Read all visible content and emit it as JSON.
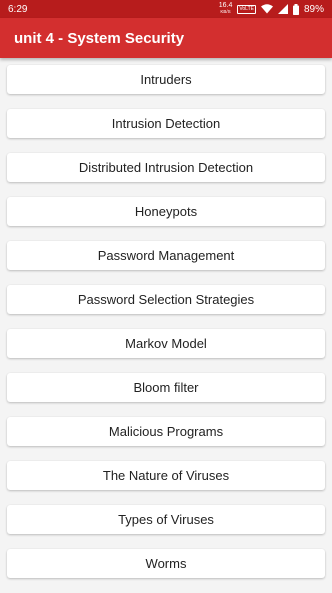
{
  "status_bar": {
    "time": "6:29",
    "net_speed_value": "16.4",
    "net_speed_unit": "KB/S",
    "volte": "VoLTE",
    "battery": "89%",
    "icons": [
      "wifi-icon",
      "signal-icon",
      "battery-icon"
    ]
  },
  "app_bar": {
    "title": "unit 4 - System Security"
  },
  "topics": [
    "Intruders",
    "Intrusion Detection",
    "Distributed Intrusion Detection",
    "Honeypots",
    "Password Management",
    "Password Selection Strategies",
    "Markov Model",
    "Bloom filter",
    "Malicious Programs",
    "The Nature of Viruses",
    "Types of Viruses",
    "Worms"
  ],
  "colors": {
    "app_bar": "#d32f2f",
    "status_bar": "#b71c1c",
    "background": "#f4f4f4"
  }
}
